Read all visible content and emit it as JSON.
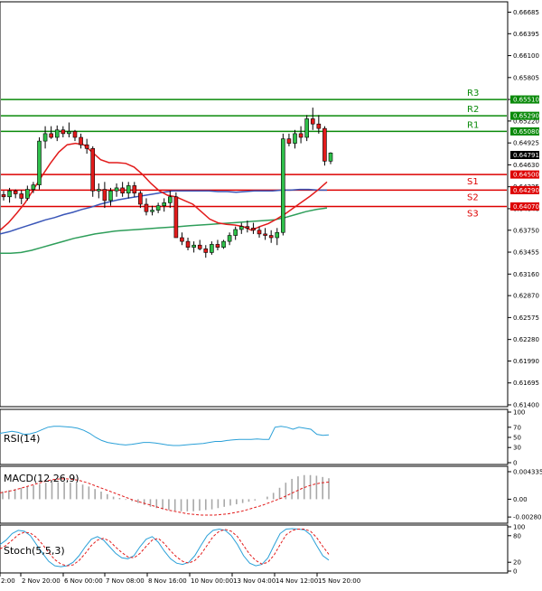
{
  "chart_data": [
    {
      "type": "candlestick",
      "panel": "price",
      "ylim": [
        0.614,
        0.668
      ],
      "y_ticks": [
        "0.66685",
        "0.66395",
        "0.66100",
        "0.65805",
        "0.65510",
        "0.65220",
        "0.64925",
        "0.64630",
        "0.64335",
        "0.64040",
        "0.63750",
        "0.63455",
        "0.63160",
        "0.62870",
        "0.62575",
        "0.62280",
        "0.61990",
        "0.61695",
        "0.61400"
      ],
      "x_ticks": [
        "2:00",
        "2 Nov 20:00",
        "6 Nov 00:00",
        "7 Nov 08:00",
        "8 Nov 16:00",
        "10 Nov 00:00",
        "13 Nov 04:00",
        "14 Nov 12:00",
        "15 Nov 20:00"
      ],
      "current_price": "0.64791",
      "levels": [
        {
          "name": "R3",
          "value": 0.6551,
          "label": "0.65510",
          "color": "#0a8a0a"
        },
        {
          "name": "R2",
          "value": 0.6529,
          "label": "0.65290",
          "color": "#0a8a0a"
        },
        {
          "name": "R1",
          "value": 0.6508,
          "label": "0.65080",
          "color": "#0a8a0a"
        },
        {
          "name": "S1",
          "value": 0.645,
          "label": "0.64500",
          "color": "#dd0000"
        },
        {
          "name": "S2",
          "value": 0.6429,
          "label": "0.64290",
          "color": "#dd0000"
        },
        {
          "name": "S3",
          "value": 0.6407,
          "label": "0.64070",
          "color": "#dd0000"
        }
      ],
      "candles": [
        [
          0.6423,
          0.6428,
          0.6415,
          0.642
        ],
        [
          0.642,
          0.6432,
          0.6412,
          0.6428
        ],
        [
          0.6428,
          0.643,
          0.6418,
          0.6424
        ],
        [
          0.6424,
          0.6429,
          0.641,
          0.6418
        ],
        [
          0.6418,
          0.6435,
          0.6415,
          0.643
        ],
        [
          0.643,
          0.644,
          0.6425,
          0.6436
        ],
        [
          0.6436,
          0.65,
          0.643,
          0.6495
        ],
        [
          0.6495,
          0.6515,
          0.6485,
          0.6505
        ],
        [
          0.6505,
          0.6515,
          0.6498,
          0.65
        ],
        [
          0.65,
          0.6516,
          0.6495,
          0.651
        ],
        [
          0.651,
          0.6515,
          0.65,
          0.6505
        ],
        [
          0.6505,
          0.652,
          0.65,
          0.6508
        ],
        [
          0.6508,
          0.651,
          0.6495,
          0.65
        ],
        [
          0.65,
          0.6505,
          0.6485,
          0.649
        ],
        [
          0.649,
          0.6498,
          0.6478,
          0.6485
        ],
        [
          0.6485,
          0.6488,
          0.642,
          0.6428
        ],
        [
          0.6428,
          0.6438,
          0.6418,
          0.643
        ],
        [
          0.643,
          0.644,
          0.6405,
          0.6415
        ],
        [
          0.6415,
          0.6432,
          0.6408,
          0.6428
        ],
        [
          0.6428,
          0.6438,
          0.642,
          0.6432
        ],
        [
          0.6432,
          0.644,
          0.642,
          0.6425
        ],
        [
          0.6425,
          0.644,
          0.6418,
          0.6435
        ],
        [
          0.6435,
          0.644,
          0.642,
          0.6425
        ],
        [
          0.6425,
          0.6428,
          0.6405,
          0.641
        ],
        [
          0.641,
          0.6418,
          0.6395,
          0.64
        ],
        [
          0.64,
          0.6408,
          0.6395,
          0.6402
        ],
        [
          0.6402,
          0.6412,
          0.6398,
          0.6408
        ],
        [
          0.6408,
          0.6418,
          0.64,
          0.6412
        ],
        [
          0.6412,
          0.6428,
          0.6405,
          0.642
        ],
        [
          0.642,
          0.6426,
          0.638,
          0.6365
        ],
        [
          0.6365,
          0.6372,
          0.6355,
          0.636
        ],
        [
          0.636,
          0.6365,
          0.6348,
          0.6352
        ],
        [
          0.6352,
          0.636,
          0.6345,
          0.6355
        ],
        [
          0.6355,
          0.6362,
          0.6348,
          0.635
        ],
        [
          0.635,
          0.6355,
          0.6338,
          0.6345
        ],
        [
          0.6345,
          0.636,
          0.6342,
          0.6356
        ],
        [
          0.6356,
          0.6362,
          0.6348,
          0.6352
        ],
        [
          0.6352,
          0.6362,
          0.635,
          0.636
        ],
        [
          0.636,
          0.6372,
          0.6355,
          0.6368
        ],
        [
          0.6368,
          0.638,
          0.6362,
          0.6376
        ],
        [
          0.6376,
          0.6385,
          0.637,
          0.638
        ],
        [
          0.638,
          0.6388,
          0.6372,
          0.6378
        ],
        [
          0.6378,
          0.6385,
          0.637,
          0.6375
        ],
        [
          0.6375,
          0.638,
          0.6365,
          0.637
        ],
        [
          0.637,
          0.6378,
          0.6362,
          0.6368
        ],
        [
          0.6368,
          0.6375,
          0.6358,
          0.6365
        ],
        [
          0.6365,
          0.6378,
          0.6355,
          0.6372
        ],
        [
          0.6372,
          0.6505,
          0.6368,
          0.6498
        ],
        [
          0.6498,
          0.6505,
          0.6488,
          0.6492
        ],
        [
          0.6492,
          0.651,
          0.6485,
          0.6505
        ],
        [
          0.6505,
          0.6515,
          0.6492,
          0.65
        ],
        [
          0.65,
          0.653,
          0.6495,
          0.6525
        ],
        [
          0.6525,
          0.654,
          0.651,
          0.6518
        ],
        [
          0.6518,
          0.653,
          0.6505,
          0.6512
        ],
        [
          0.6512,
          0.6515,
          0.6462,
          0.6468
        ],
        [
          0.6468,
          0.648,
          0.6464,
          0.6479
        ]
      ],
      "ma_fast": [
        0.6375,
        0.6385,
        0.6398,
        0.6412,
        0.643,
        0.6448,
        0.6465,
        0.648,
        0.649,
        0.6492,
        0.649,
        0.648,
        0.647,
        0.6466,
        0.6466,
        0.6465,
        0.646,
        0.645,
        0.6438,
        0.6428,
        0.6422,
        0.642,
        0.6415,
        0.641,
        0.64,
        0.639,
        0.6385,
        0.6383,
        0.6382,
        0.638,
        0.6375,
        0.638,
        0.6384,
        0.639,
        0.6397,
        0.6405,
        0.6413,
        0.6421,
        0.643,
        0.644
      ],
      "ma_fast_x0": 0,
      "ma_blue": [
        0.637,
        0.6373,
        0.6377,
        0.6381,
        0.6385,
        0.6389,
        0.6392,
        0.6396,
        0.6399,
        0.6403,
        0.6406,
        0.641,
        0.6413,
        0.6416,
        0.6418,
        0.642,
        0.6422,
        0.6424,
        0.6426,
        0.6428,
        0.6428,
        0.6428,
        0.6428,
        0.6428,
        0.6427,
        0.6427,
        0.6426,
        0.6427,
        0.6428,
        0.6428,
        0.6428,
        0.6429,
        0.6429,
        0.643,
        0.643,
        0.6429,
        0.6429
      ],
      "ma_green": [
        0.6344,
        0.6344,
        0.6345,
        0.6348,
        0.6352,
        0.6356,
        0.636,
        0.6364,
        0.6367,
        0.637,
        0.6372,
        0.6374,
        0.6375,
        0.6376,
        0.6377,
        0.6378,
        0.6379,
        0.638,
        0.6381,
        0.6382,
        0.6383,
        0.6384,
        0.6385,
        0.6386,
        0.6387,
        0.6388,
        0.6389,
        0.6392,
        0.6396,
        0.64,
        0.6403,
        0.6405
      ]
    },
    {
      "type": "line",
      "panel": "rsi",
      "title": "RSI(14)",
      "ylim": [
        0,
        100
      ],
      "y_ticks": [
        "100",
        "70",
        "50",
        "30",
        "0"
      ],
      "values": [
        58,
        60,
        62,
        60,
        56,
        57,
        60,
        65,
        70,
        72,
        72,
        71,
        70,
        68,
        64,
        58,
        50,
        44,
        40,
        38,
        36,
        35,
        36,
        38,
        40,
        40,
        39,
        37,
        35,
        34,
        34,
        35,
        36,
        37,
        38,
        40,
        42,
        42,
        44,
        45,
        46,
        46,
        46,
        47,
        46,
        46,
        70,
        72,
        70,
        66,
        70,
        68,
        66,
        56,
        54,
        55
      ]
    },
    {
      "type": "bar+line",
      "panel": "macd",
      "title": "MACD(12,26,9)",
      "ylim": [
        -0.0035,
        0.0049
      ],
      "y_ticks": [
        "0.004335",
        "0.00",
        "-0.002807"
      ],
      "histogram": [
        0.0012,
        0.0014,
        0.0016,
        0.0018,
        0.002,
        0.0022,
        0.0024,
        0.0026,
        0.0027,
        0.0027,
        0.0027,
        0.0026,
        0.0025,
        0.0023,
        0.002,
        0.0016,
        0.0012,
        0.0008,
        0.0004,
        0.0002,
        -0.0001,
        -0.0003,
        -0.0006,
        -0.0009,
        -0.0012,
        -0.0014,
        -0.0016,
        -0.0017,
        -0.0018,
        -0.0019,
        -0.0019,
        -0.0019,
        -0.0018,
        -0.0017,
        -0.0016,
        -0.0014,
        -0.0012,
        -0.001,
        -0.0008,
        -0.0006,
        -0.0004,
        -0.0002,
        0.0,
        0.0004,
        0.001,
        0.0018,
        0.0026,
        0.0032,
        0.0036,
        0.0038,
        0.0038,
        0.0037,
        0.0035,
        0.0033
      ],
      "signal": [
        0.001,
        0.0012,
        0.0014,
        0.0017,
        0.002,
        0.0023,
        0.0026,
        0.0029,
        0.0031,
        0.0032,
        0.0032,
        0.0031,
        0.0029,
        0.0026,
        0.0022,
        0.0018,
        0.0014,
        0.001,
        0.0006,
        0.0002,
        -0.0002,
        -0.0005,
        -0.0008,
        -0.0011,
        -0.0014,
        -0.0017,
        -0.0019,
        -0.0021,
        -0.0023,
        -0.0024,
        -0.0025,
        -0.0025,
        -0.0025,
        -0.0024,
        -0.0023,
        -0.0021,
        -0.0019,
        -0.0016,
        -0.0013,
        -0.001,
        -0.0006,
        -0.0002,
        0.0002,
        0.0007,
        0.0012,
        0.0017,
        0.0021,
        0.0024,
        0.0026,
        0.0027
      ]
    },
    {
      "type": "line",
      "panel": "stoch",
      "title": "Stoch(5,5,3)",
      "ylim": [
        0,
        100
      ],
      "y_ticks": [
        "100",
        "80",
        "20",
        "0"
      ],
      "main": [
        60,
        70,
        85,
        92,
        90,
        80,
        60,
        40,
        22,
        12,
        10,
        12,
        20,
        35,
        55,
        72,
        78,
        70,
        55,
        40,
        30,
        28,
        35,
        55,
        72,
        78,
        65,
        45,
        28,
        18,
        15,
        20,
        35,
        58,
        80,
        92,
        95,
        92,
        80,
        60,
        35,
        18,
        12,
        15,
        30,
        58,
        85,
        95,
        96,
        95,
        93,
        82,
        58,
        35,
        25
      ],
      "signal": [
        50,
        58,
        70,
        82,
        88,
        86,
        76,
        60,
        42,
        26,
        16,
        12,
        14,
        24,
        40,
        58,
        70,
        74,
        68,
        54,
        42,
        32,
        30,
        40,
        56,
        70,
        74,
        62,
        46,
        32,
        22,
        18,
        24,
        38,
        58,
        78,
        90,
        94,
        90,
        78,
        58,
        38,
        24,
        16,
        20,
        36,
        60,
        82,
        92,
        95,
        95,
        90,
        76,
        56,
        38
      ]
    }
  ]
}
